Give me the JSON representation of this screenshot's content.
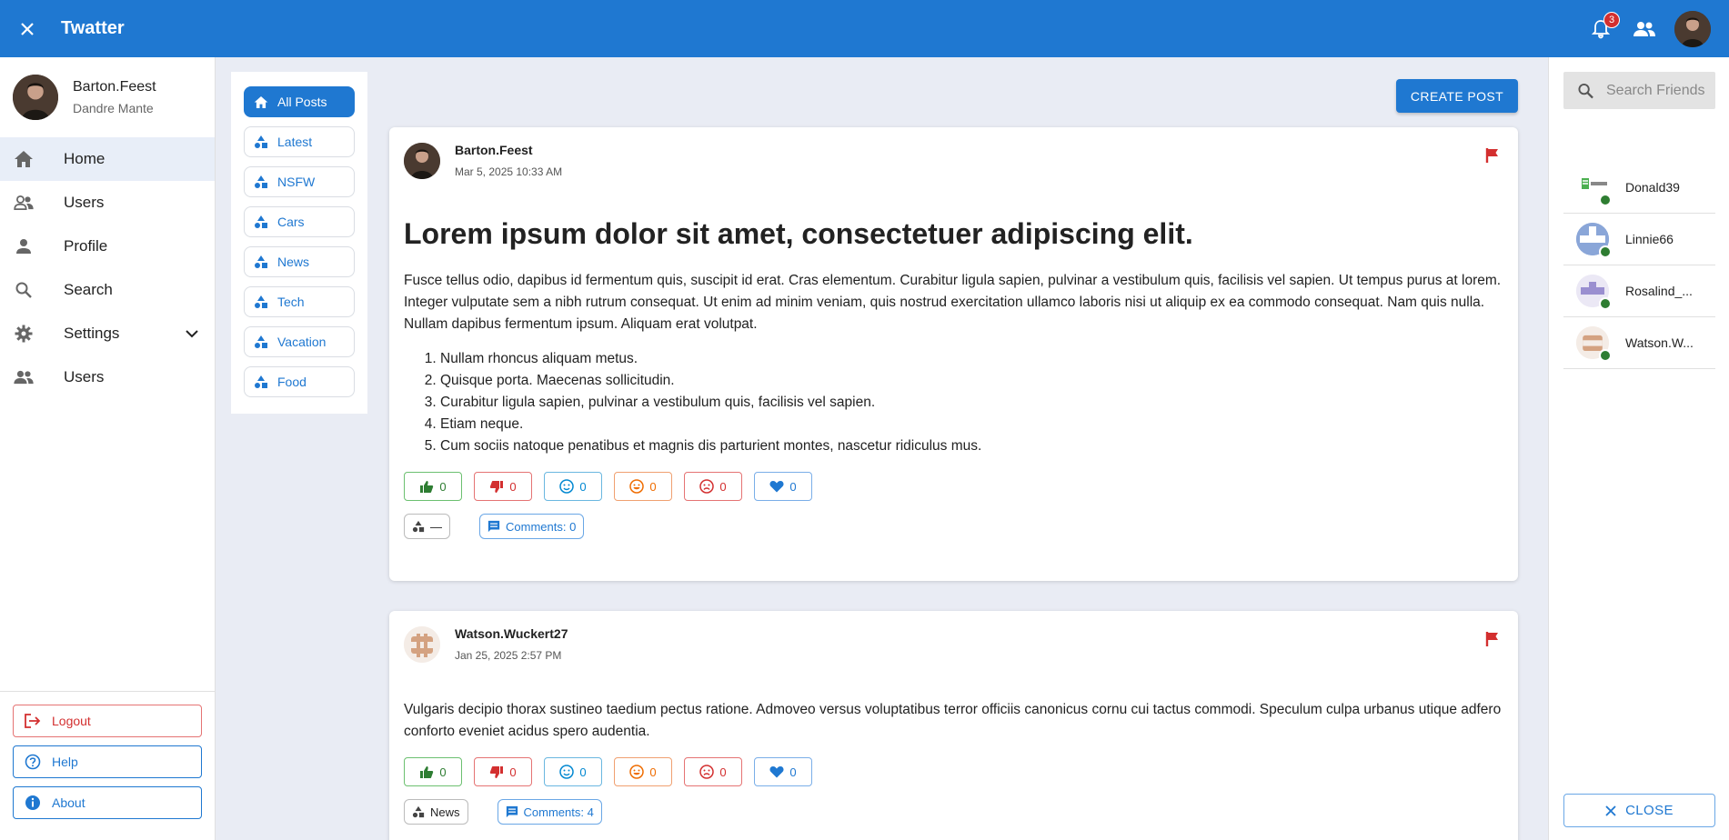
{
  "app": {
    "title": "Twatter",
    "notification_count": "3"
  },
  "colors": {
    "primary": "#1f78d1",
    "danger": "#d32f2f",
    "success": "#2e7d32",
    "warning": "#ef6c00",
    "info": "#0288d1"
  },
  "profile": {
    "username": "Barton.Feest",
    "full_name": "Dandre Mante"
  },
  "nav": {
    "items": [
      {
        "label": "Home",
        "icon": "home-icon"
      },
      {
        "label": "Users",
        "icon": "users-icon"
      },
      {
        "label": "Profile",
        "icon": "person-icon"
      },
      {
        "label": "Search",
        "icon": "search-icon"
      },
      {
        "label": "Settings",
        "icon": "gear-icon"
      },
      {
        "label": "Users",
        "icon": "users-icon"
      }
    ],
    "logout": "Logout",
    "help": "Help",
    "about": "About"
  },
  "categories": [
    "All Posts",
    "Latest",
    "NSFW",
    "Cars",
    "News",
    "Tech",
    "Vacation",
    "Food"
  ],
  "create_post": "CREATE POST",
  "posts": [
    {
      "author": "Barton.Feest",
      "date": "Mar 5, 2025 10:33 AM",
      "title": "Lorem ipsum dolor sit amet, consectetuer adipiscing elit.",
      "body": "Fusce tellus odio, dapibus id fermentum quis, suscipit id erat. Cras elementum. Curabitur ligula sapien, pulvinar a vestibulum quis, facilisis vel sapien. Ut tempus purus at lorem. Integer vulputate sem a nibh rutrum consequat. Ut enim ad minim veniam, quis nostrud exercitation ullamco laboris nisi ut aliquip ex ea commodo consequat. Nam quis nulla. Nullam dapibus fermentum ipsum. Aliquam erat volutpat.",
      "list": [
        "Nullam rhoncus aliquam metus.",
        "Quisque porta. Maecenas sollicitudin.",
        "Curabitur ligula sapien, pulvinar a vestibulum quis, facilisis vel sapien.",
        "Etiam neque.",
        "Cum sociis natoque penatibus et magnis dis parturient montes, nascetur ridiculus mus."
      ],
      "reactions": {
        "like": "0",
        "dislike": "0",
        "neutral": "0",
        "happy": "0",
        "sad": "0",
        "love": "0"
      },
      "category": "—",
      "comments": "Comments: 0"
    },
    {
      "author": "Watson.Wuckert27",
      "date": "Jan 25, 2025 2:57 PM",
      "body": "Vulgaris decipio thorax sustineo taedium pectus ratione. Admoveo versus voluptatibus terror officiis canonicus cornu cui tactus commodi. Speculum culpa urbanus utique adfero conforto eveniet acidus spero audentia.",
      "reactions": {
        "like": "0",
        "dislike": "0",
        "neutral": "0",
        "happy": "0",
        "sad": "0",
        "love": "0"
      },
      "category": "News",
      "comments": "Comments: 4"
    }
  ],
  "friends": {
    "search_placeholder": "Search Friends",
    "list": [
      {
        "name": "Donald39",
        "status": "online"
      },
      {
        "name": "Linnie66",
        "status": "online"
      },
      {
        "name": "Rosalind_...",
        "status": "online"
      },
      {
        "name": "Watson.W...",
        "status": "online"
      }
    ],
    "close": "CLOSE"
  }
}
